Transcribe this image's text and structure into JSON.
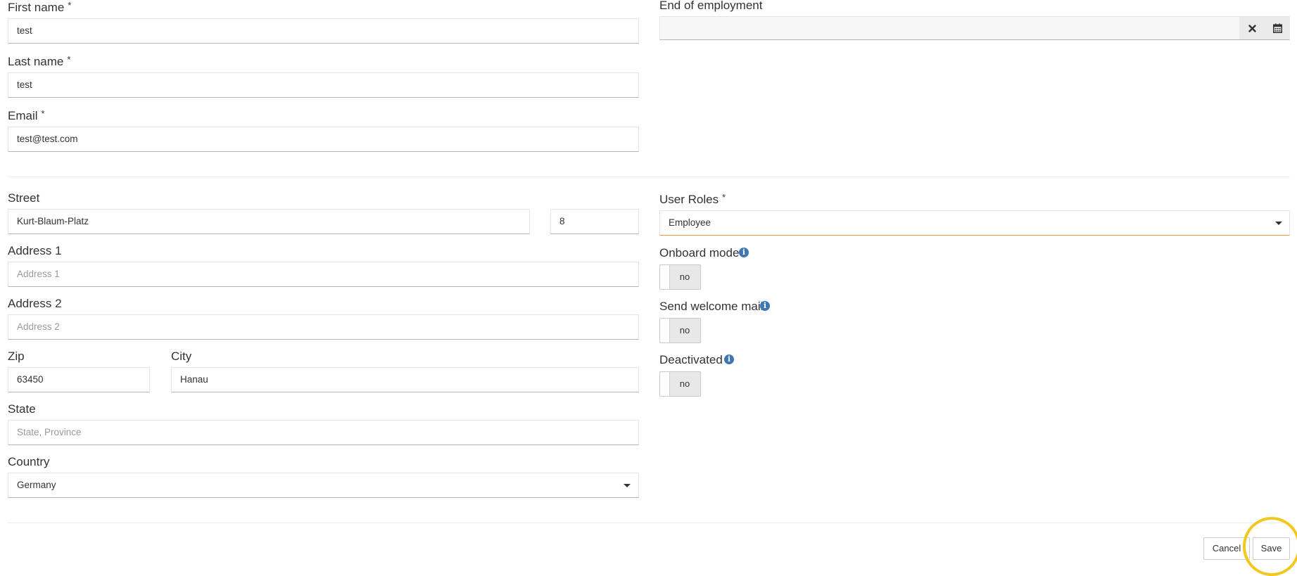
{
  "personal": {
    "first_name_label": "First name",
    "first_name_value": "test",
    "last_name_label": "Last name",
    "last_name_value": "test",
    "email_label": "Email",
    "email_value": "test@test.com",
    "required_marker": "*"
  },
  "employment": {
    "end_label": "End of employment",
    "end_value": ""
  },
  "address": {
    "street_label": "Street",
    "street_value": "Kurt-Blaum-Platz",
    "house_number_value": "8",
    "address1_label": "Address 1",
    "address1_placeholder": "Address 1",
    "address2_label": "Address 2",
    "address2_placeholder": "Address 2",
    "zip_label": "Zip",
    "zip_value": "63450",
    "city_label": "City",
    "city_value": "Hanau",
    "state_label": "State",
    "state_placeholder": "State, Province",
    "country_label": "Country",
    "country_value": "Germany"
  },
  "settings": {
    "roles_label": "User Roles",
    "roles_value": "Employee",
    "onboard_label": "Onboard mode",
    "onboard_value": "no",
    "welcome_label": "Send welcome mail",
    "welcome_value": "no",
    "deactivated_label": "Deactivated",
    "deactivated_value": "no",
    "info_glyph": "i"
  },
  "footer": {
    "cancel_label": "Cancel",
    "save_label": "Save"
  },
  "icons": {
    "clear": "close-icon",
    "calendar": "calendar-icon",
    "dropdown": "chevron-down-icon",
    "info": "info-icon"
  },
  "colors": {
    "accent_border": "#e29a3a",
    "info_blue": "#3f77b3",
    "highlight_ring": "#f2c81e"
  }
}
